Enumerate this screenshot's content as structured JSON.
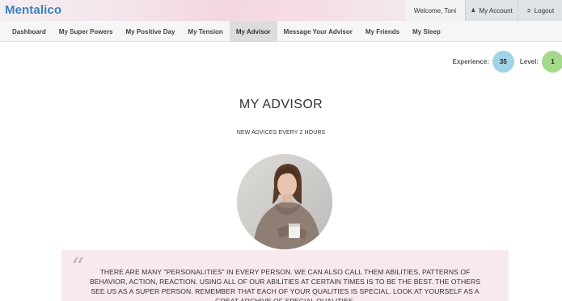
{
  "header": {
    "brand": "Mentalico",
    "welcome": "Welcome, Toni",
    "account_label": "My Account",
    "logout_label": "Logout"
  },
  "nav": {
    "items": [
      {
        "label": "Dashboard"
      },
      {
        "label": "My Super Powers"
      },
      {
        "label": "My Positive Day"
      },
      {
        "label": "My Tension"
      },
      {
        "label": "My Advisor",
        "active": true
      },
      {
        "label": "Message Your Advisor"
      },
      {
        "label": "My Friends"
      },
      {
        "label": "My Sleep"
      }
    ]
  },
  "stats": {
    "experience_label": "Experience:",
    "experience_value": "35",
    "level_label": "Level:",
    "level_value": "1",
    "experience_color": "#9fd3e5",
    "level_color": "#a5d98c"
  },
  "page": {
    "title": "MY ADVISOR",
    "subtitle": "NEW ADVICES EVERY 2 HOURS"
  },
  "advice": {
    "quote_mark": "“",
    "text": "THERE ARE MANY \"PERSONALITIES\" IN EVERY PERSON. WE CAN ALSO CALL THEM ABILITIES, PATTERNS OF BEHAVIOR, ACTION, REACTION. USING ALL OF OUR ABILITIES AT CERTAIN TIMES IS TO BE THE BEST. THE OTHERS SEE US AS A SUPER PERSON. REMEMBER THAT EACH OF YOUR QUALITIES IS SPECIAL. LOOK AT YOURSELF AS A GREAT ARCHIVE OF SPECIAL QUALITIES."
  },
  "colors": {
    "brand": "#3c7fc0",
    "quote_background": "#f8e9ee",
    "active_tab": "#dcdcdc"
  },
  "icons": {
    "account": "user-icon",
    "logout": "logout-icon"
  }
}
